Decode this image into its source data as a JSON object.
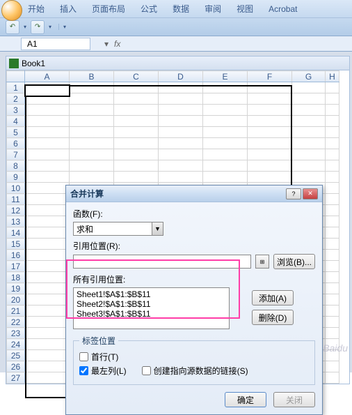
{
  "ribbon": {
    "tabs": [
      "开始",
      "插入",
      "页面布局",
      "公式",
      "数据",
      "审阅",
      "视图",
      "Acrobat"
    ]
  },
  "namebox": {
    "value": "A1"
  },
  "formula": {
    "fx": "fx"
  },
  "workbook": {
    "title": "Book1"
  },
  "columns": [
    "A",
    "B",
    "C",
    "D",
    "E",
    "F",
    "G",
    "H"
  ],
  "rows": [
    "1",
    "2",
    "3",
    "4",
    "5",
    "6",
    "7",
    "8",
    "9",
    "10",
    "11",
    "12",
    "13",
    "14",
    "15",
    "16",
    "17",
    "18",
    "19",
    "20",
    "21",
    "22",
    "23",
    "24",
    "25",
    "26",
    "27"
  ],
  "dialog": {
    "title": "合并计算",
    "func_label": "函数(F):",
    "func_value": "求和",
    "ref_label": "引用位置(R):",
    "all_ref_label": "所有引用位置:",
    "refs": [
      "Sheet1!$A$1:$B$11",
      "Sheet2!$A$1:$B$11",
      "Sheet3!$A$1:$B$11"
    ],
    "browse": "浏览(B)...",
    "add": "添加(A)",
    "delete": "删除(D)",
    "labels_group": "标签位置",
    "top_row": "首行(T)",
    "left_col": "最左列(L)",
    "create_links": "创建指向源数据的链接(S)",
    "ok": "确定",
    "close": "关闭"
  },
  "watermark": "Baidu"
}
